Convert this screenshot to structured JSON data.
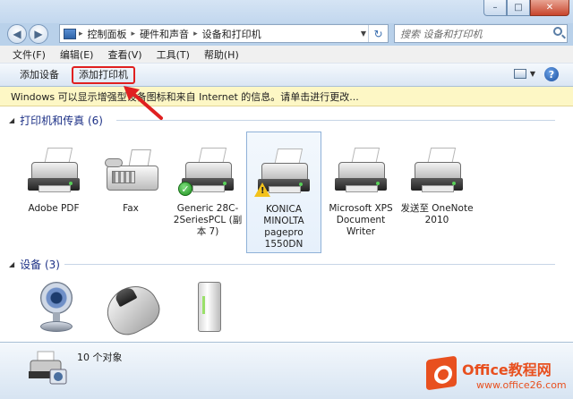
{
  "window": {
    "caption_min": "–",
    "caption_max": "□",
    "caption_close": "✕"
  },
  "nav": {
    "back": "◀",
    "forward": "▶",
    "address": [
      "控制面板",
      "硬件和声音",
      "设备和打印机"
    ],
    "separator": "▸",
    "refresh": "↻",
    "search_placeholder": "搜索 设备和打印机"
  },
  "menu": [
    "文件(F)",
    "编辑(E)",
    "查看(V)",
    "工具(T)",
    "帮助(H)"
  ],
  "commands": {
    "add_device": "添加设备",
    "add_printer": "添加打印机",
    "help": "?"
  },
  "infobar": {
    "text": "Windows 可以显示增强型设备图标和来自 Internet 的信息。请单击进行更改..."
  },
  "groups": {
    "printers": {
      "title": "打印机和传真 (6)",
      "items": [
        {
          "label": "Adobe PDF",
          "icon": "printer-icon"
        },
        {
          "label": "Fax",
          "icon": "fax-icon"
        },
        {
          "label": "Generic 28C-2SeriesPCL (副本 7)",
          "icon": "printer-icon",
          "status": "default"
        },
        {
          "label": "KONICA MINOLTA pagepro 1550DN",
          "icon": "printer-icon",
          "status": "warning"
        },
        {
          "label": "Microsoft XPS Document Writer",
          "icon": "printer-icon"
        },
        {
          "label": "发送至 OneNote 2010",
          "icon": "printer-icon"
        }
      ]
    },
    "devices": {
      "title": "设备 (3)",
      "items": [
        {
          "icon": "webcam-icon"
        },
        {
          "icon": "mouse-icon"
        },
        {
          "icon": "external-drive-icon"
        }
      ]
    }
  },
  "status": {
    "count": "10 个对象"
  },
  "watermark": {
    "title": "Office教程网",
    "url": "www.office26.com"
  },
  "colors": {
    "accent": "#1e3287",
    "highlight_red": "#e02020",
    "infobar_bg": "#fdf7c5",
    "watermark_orange": "#e8501f"
  }
}
